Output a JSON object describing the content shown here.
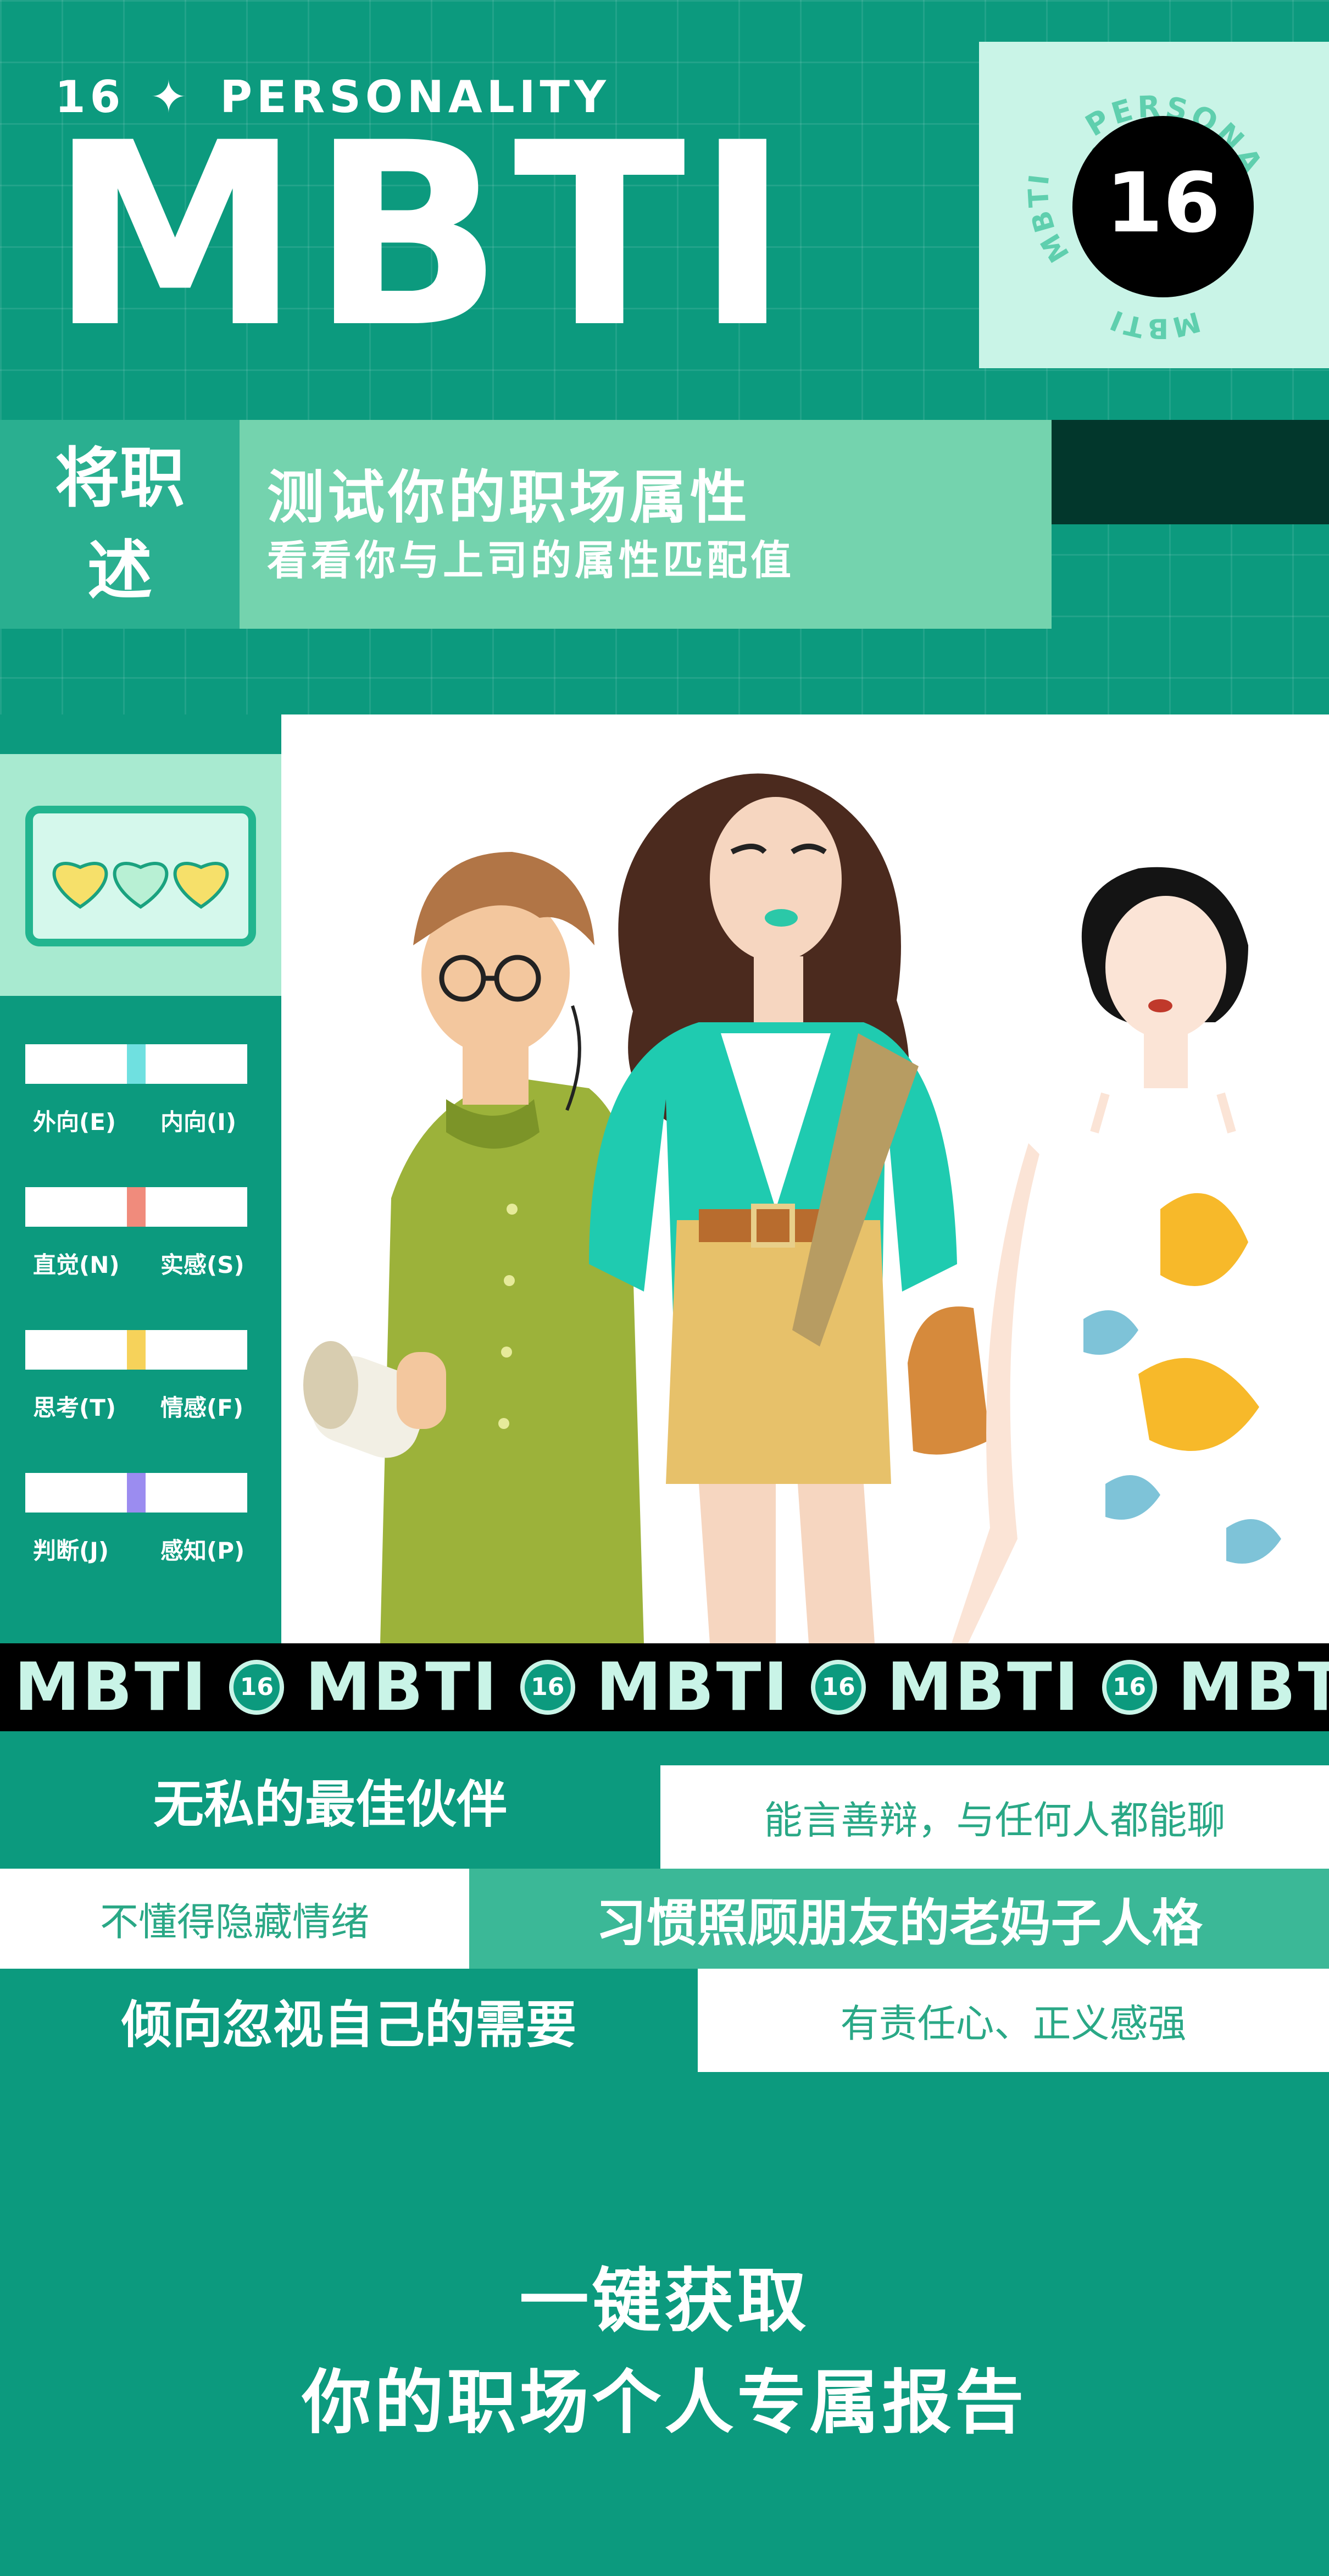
{
  "header": {
    "eyebrow_number": "16",
    "eyebrow_star": "✦",
    "eyebrow_text": "PERSONALITY",
    "title": "MBTI"
  },
  "badge": {
    "number": "16",
    "ring_top": "PERSONALITY",
    "ring_left": "MBTI",
    "ring_bottom": "MBTI"
  },
  "intro": {
    "label_line1": "将职",
    "label_line2": "述",
    "main": "测试你的职场属性",
    "sub": "看看你与上司的属性匹配值"
  },
  "hearts": {
    "count": 3,
    "colors": [
      "#f6e06a",
      "#b8f0d4",
      "#f6e06a"
    ]
  },
  "scales": [
    {
      "left": "外向(E)",
      "right": "内向(I)",
      "marker_color": "#6fe0e0",
      "level": 0.5
    },
    {
      "left": "直觉(N)",
      "right": "实感(S)",
      "marker_color": "#f08b7c",
      "level": 0.5
    },
    {
      "left": "思考(T)",
      "right": "情感(F)",
      "marker_color": "#f6d25a",
      "level": 0.5
    },
    {
      "left": "判断(J)",
      "right": "感知(P)",
      "marker_color": "#9b8cf0",
      "level": 0.5
    }
  ],
  "ticker": {
    "word": "MBTI",
    "badge": "16"
  },
  "traits": [
    {
      "text": "无私的最佳伙伴",
      "style": "bold"
    },
    {
      "text": "能言善辩，与任何人都能聊",
      "style": "light"
    },
    {
      "text": "不懂得隐藏情绪",
      "style": "light"
    },
    {
      "text": "习惯照顾朋友的老妈子人格",
      "style": "bold"
    },
    {
      "text": "倾向忽视自己的需要",
      "style": "bold"
    },
    {
      "text": "有责任心、正义感强",
      "style": "light"
    }
  ],
  "cta": {
    "line1": "一键获取",
    "line2": "你的职场个人专属报告"
  },
  "colors": {
    "background": "#0c9a7e",
    "mint": "#c9f4e7",
    "mid_green": "#2aaf90",
    "light_green": "#74d3ae",
    "dark_green": "#02372c",
    "band": "#3bb897"
  }
}
